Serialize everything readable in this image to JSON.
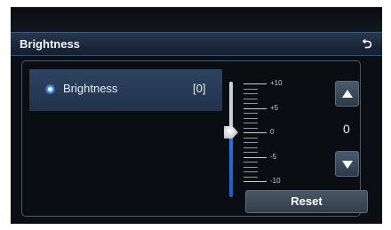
{
  "header": {
    "title": "Brightness",
    "back_icon": "back-arrow-icon"
  },
  "option": {
    "label": "Brightness",
    "value": "[0]",
    "selected": true
  },
  "slider": {
    "value": 0,
    "min": -10,
    "max": 10,
    "labels": [
      "+10",
      "+5",
      "0",
      "-5",
      "-10"
    ]
  },
  "stepper": {
    "value": "0",
    "up_icon": "up-arrow-icon",
    "down_icon": "down-arrow-icon"
  },
  "reset": {
    "label": "Reset"
  }
}
